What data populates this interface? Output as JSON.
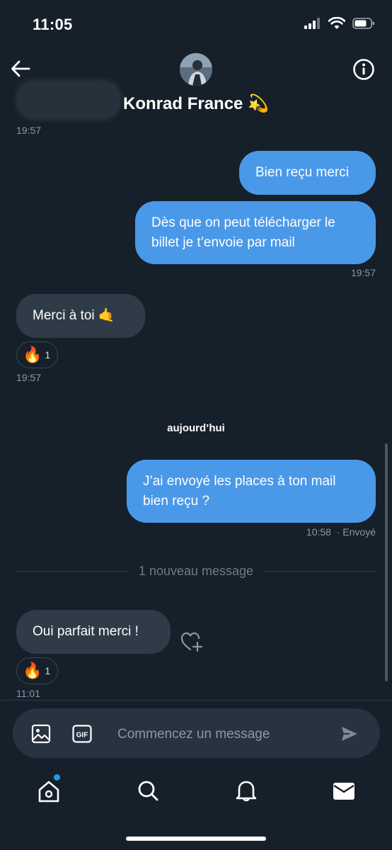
{
  "status": {
    "time": "11:05"
  },
  "header": {
    "name": "Konrad France",
    "badge_emoji": "💫"
  },
  "messages": {
    "m0_time": "19:57",
    "m1_text": "Bien reçu merci",
    "m2_line1": "Dès que on peut télécharger le",
    "m2_line2": "billet je t’envoie par mail",
    "m2_time": "19:57",
    "m3_text": "Merci à toi 🤙",
    "m3_reaction_emoji": "🔥",
    "m3_reaction_count": "1",
    "m3_time": "19:57",
    "day_separator": "aujourd’hui",
    "m4_line1": "J’ai envoyé les places à ton mail",
    "m4_line2": "bien reçu ?",
    "m4_time": "10:58",
    "m4_status": "· Envoyé",
    "new_messages": "1 nouveau message",
    "m5_text": "Oui parfait merci !",
    "m5_reaction_emoji": "🔥",
    "m5_reaction_count": "1",
    "m5_time": "11:01"
  },
  "composer": {
    "placeholder": "Commencez un message",
    "gif_label": "GIF"
  },
  "nav": {
    "items": [
      "home-icon",
      "search-icon",
      "bell-icon",
      "mail-icon"
    ],
    "home_dot_color": "#1d9bf0"
  },
  "colors": {
    "background": "#15202b",
    "outgoing": "#4a99e9",
    "incoming": "#2f3b47"
  }
}
